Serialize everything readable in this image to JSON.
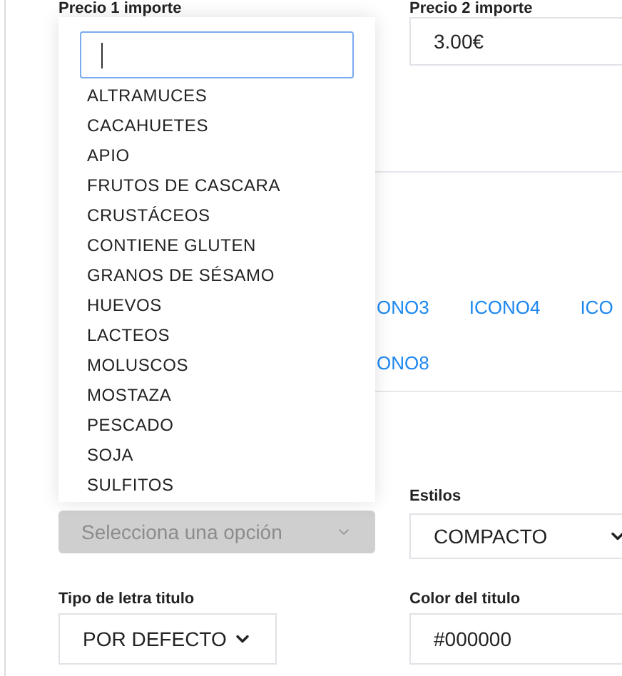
{
  "price_fields": [
    {
      "label": "Precio 1 importe"
    },
    {
      "label": "Precio 2 importe",
      "value": "3.00€"
    }
  ],
  "icon_link_rows": [
    {
      "links": [
        "ONO3",
        "ICONO4",
        "ICO"
      ]
    },
    {
      "links": [
        "ONO8"
      ]
    }
  ],
  "allergen_select": {
    "placeholder": "Selecciona una opción",
    "disabled": true,
    "open": true,
    "search": {
      "focused": true
    },
    "options": [
      "ALTRAMUCES",
      "CACAHUETES",
      "APIO",
      "FRUTOS DE CASCARA",
      "CRUSTÁCEOS",
      "CONTIENE GLUTEN",
      "GRANOS DE SÉSAMO",
      "HUEVOS",
      "LACTEOS",
      "MOLUSCOS",
      "MOSTAZA",
      "PESCADO",
      "SOJA",
      "SULFITOS"
    ]
  },
  "styles_select": {
    "label": "Estilos",
    "value": "COMPACTO"
  },
  "title_font_select": {
    "label": "Tipo de letra titulo",
    "value": "POR DEFECTO"
  },
  "title_color": {
    "label": "Color del titulo",
    "value": "#000000"
  }
}
